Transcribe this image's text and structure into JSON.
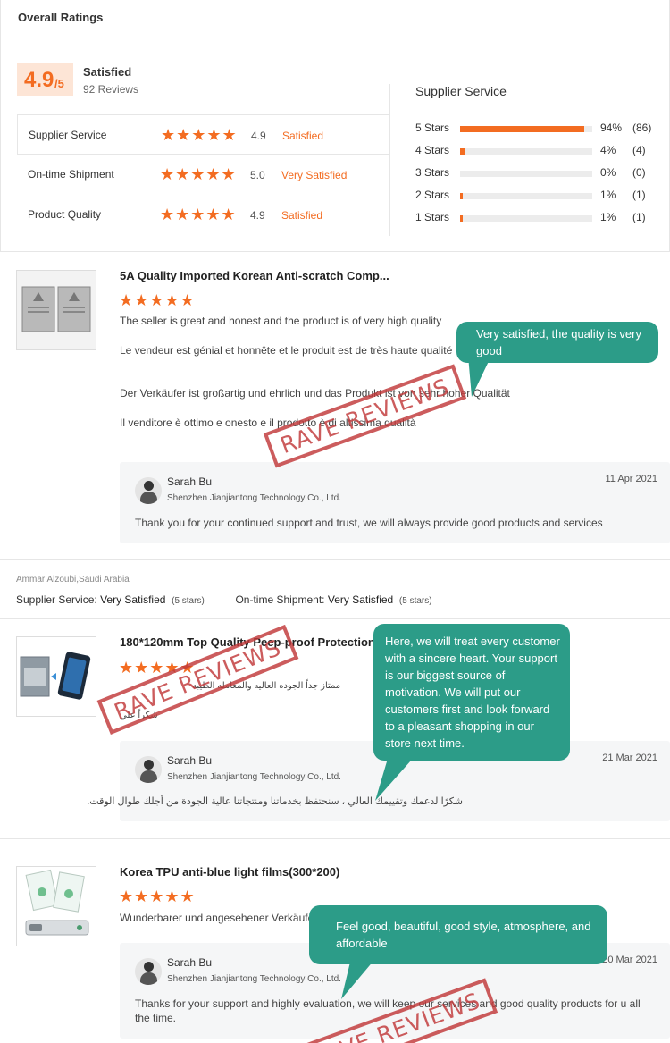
{
  "overall": {
    "title": "Overall Ratings",
    "score": "4.9",
    "score_suffix": "/5",
    "level": "Satisfied",
    "reviews": "92 Reviews",
    "rows": [
      {
        "label": "Supplier Service",
        "stars": "★★★★★",
        "score": "4.9",
        "level": "Satisfied"
      },
      {
        "label": "On-time Shipment",
        "stars": "★★★★★",
        "score": "5.0",
        "level": "Very Satisfied"
      },
      {
        "label": "Product Quality",
        "stars": "★★★★★",
        "score": "4.9",
        "level": "Satisfied"
      }
    ],
    "distribution_title": "Supplier Service",
    "distribution": [
      {
        "label": "5  Stars",
        "fraction": 0.94,
        "pct": "94%",
        "count": "(86)"
      },
      {
        "label": "4  Stars",
        "fraction": 0.04,
        "pct": "4%",
        "count": "(4)"
      },
      {
        "label": "3  Stars",
        "fraction": 0.0,
        "pct": "0%",
        "count": "(0)"
      },
      {
        "label": "2  Stars",
        "fraction": 0.01,
        "pct": "1%",
        "count": "(1)"
      },
      {
        "label": "1  Stars",
        "fraction": 0.01,
        "pct": "1%",
        "count": "(1)"
      }
    ],
    "accent": "#f36c21"
  },
  "reviews": [
    {
      "title": "5A Quality Imported Korean Anti-scratch Comp...",
      "stars": "★★★★★",
      "texts": [
        "The seller is great and honest and the product is of very high quality",
        "Le vendeur est génial et honnête et le produit est de très haute qualité",
        "Der Verkäufer ist großartig und ehrlich und das Produkt ist von sehr hoher Qualität",
        "Il venditore è ottimo e onesto e il prodotto è di altissima qualità"
      ],
      "reply": {
        "name": "Sarah Bu",
        "company": "Shenzhen Jianjiantong Technology Co., Ltd.",
        "date": "11 Apr 2021",
        "text": "Thank you for your continued support and trust, we will always provide good products and services"
      }
    },
    {
      "buyer": "Ammar Alzoubi,Saudi Arabia",
      "supplier_service_label": "Supplier Service:",
      "supplier_service_value": "Very Satisfied",
      "supplier_service_stars": "(5 stars)",
      "shipment_label": "On-time Shipment:",
      "shipment_value": "Very Satisfied",
      "shipment_stars": "(5 stars)",
      "title": "180*120mm Top Quality Peep-proof Protection",
      "stars": "★★★★★",
      "texts": [
        "ممتاز جداً الجوده العاليه والمعامله الطيبه",
        "شكراً علي"
      ],
      "reply": {
        "name": "Sarah Bu",
        "company": "Shenzhen Jianjiantong Technology Co., Ltd.",
        "date": "21 Mar 2021",
        "text": "شكرًا لدعمك وتقييمك العالي ، سنحتفظ بخدماتنا ومنتجاتنا عالية الجودة من أجلك طوال الوقت."
      }
    },
    {
      "title": "Korea TPU anti-blue light films(300*200)",
      "stars": "★★★★★",
      "texts": [
        "Wunderbarer und angesehener Verkäufer"
      ],
      "reply": {
        "name": "Sarah Bu",
        "company": "Shenzhen Jianjiantong Technology Co., Ltd.",
        "date": "20 Mar 2021",
        "text": "Thanks for your support and highly evaluation, we will keep our services and good quality products for u all the time."
      }
    }
  ],
  "callouts": [
    "Very satisfied, the quality is very good",
    "Here, we will treat every customer with a sincere heart. Your support is our biggest source of motivation. We will put our customers first and look forward to a pleasant shopping in our store next time.",
    "Feel good, beautiful, good style, atmosphere, and affordable"
  ],
  "stamp_text": "RAVE REVIEWS",
  "callout_color": "#2c9c88",
  "stamp_color": "#c1393a"
}
